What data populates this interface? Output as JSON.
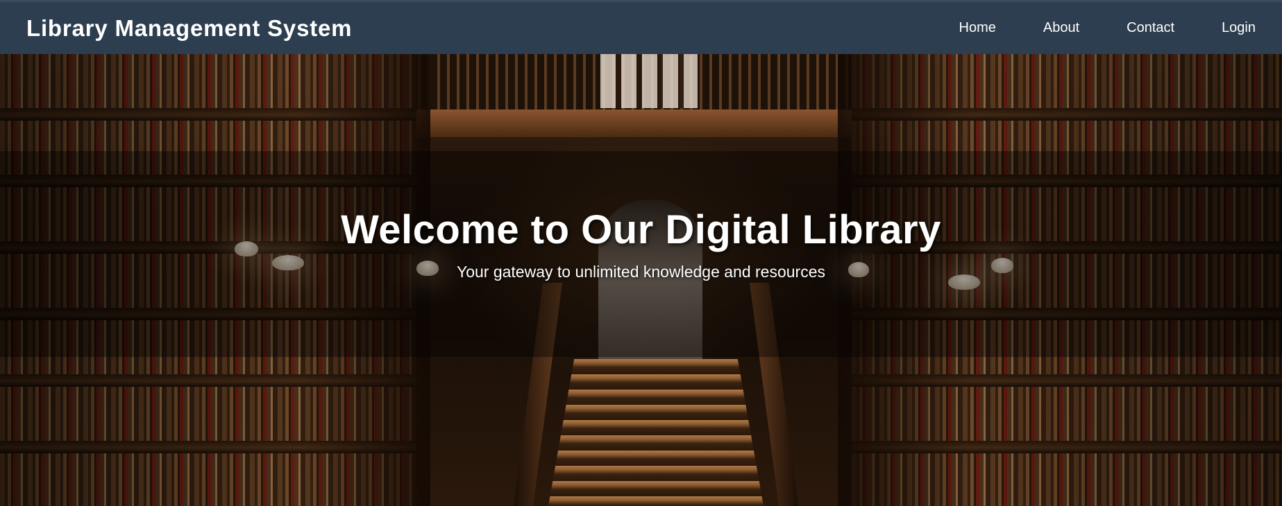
{
  "navbar": {
    "brand": "Library Management System",
    "links": [
      {
        "label": "Home"
      },
      {
        "label": "About"
      },
      {
        "label": "Contact"
      },
      {
        "label": "Login"
      }
    ]
  },
  "hero": {
    "title": "Welcome to Our Digital Library",
    "subtitle": "Your gateway to unlimited knowledge and resources",
    "background": "library-bookshelves-staircase-photo"
  },
  "colors": {
    "navbar_bg": "#2d3e50",
    "text": "#ffffff"
  }
}
